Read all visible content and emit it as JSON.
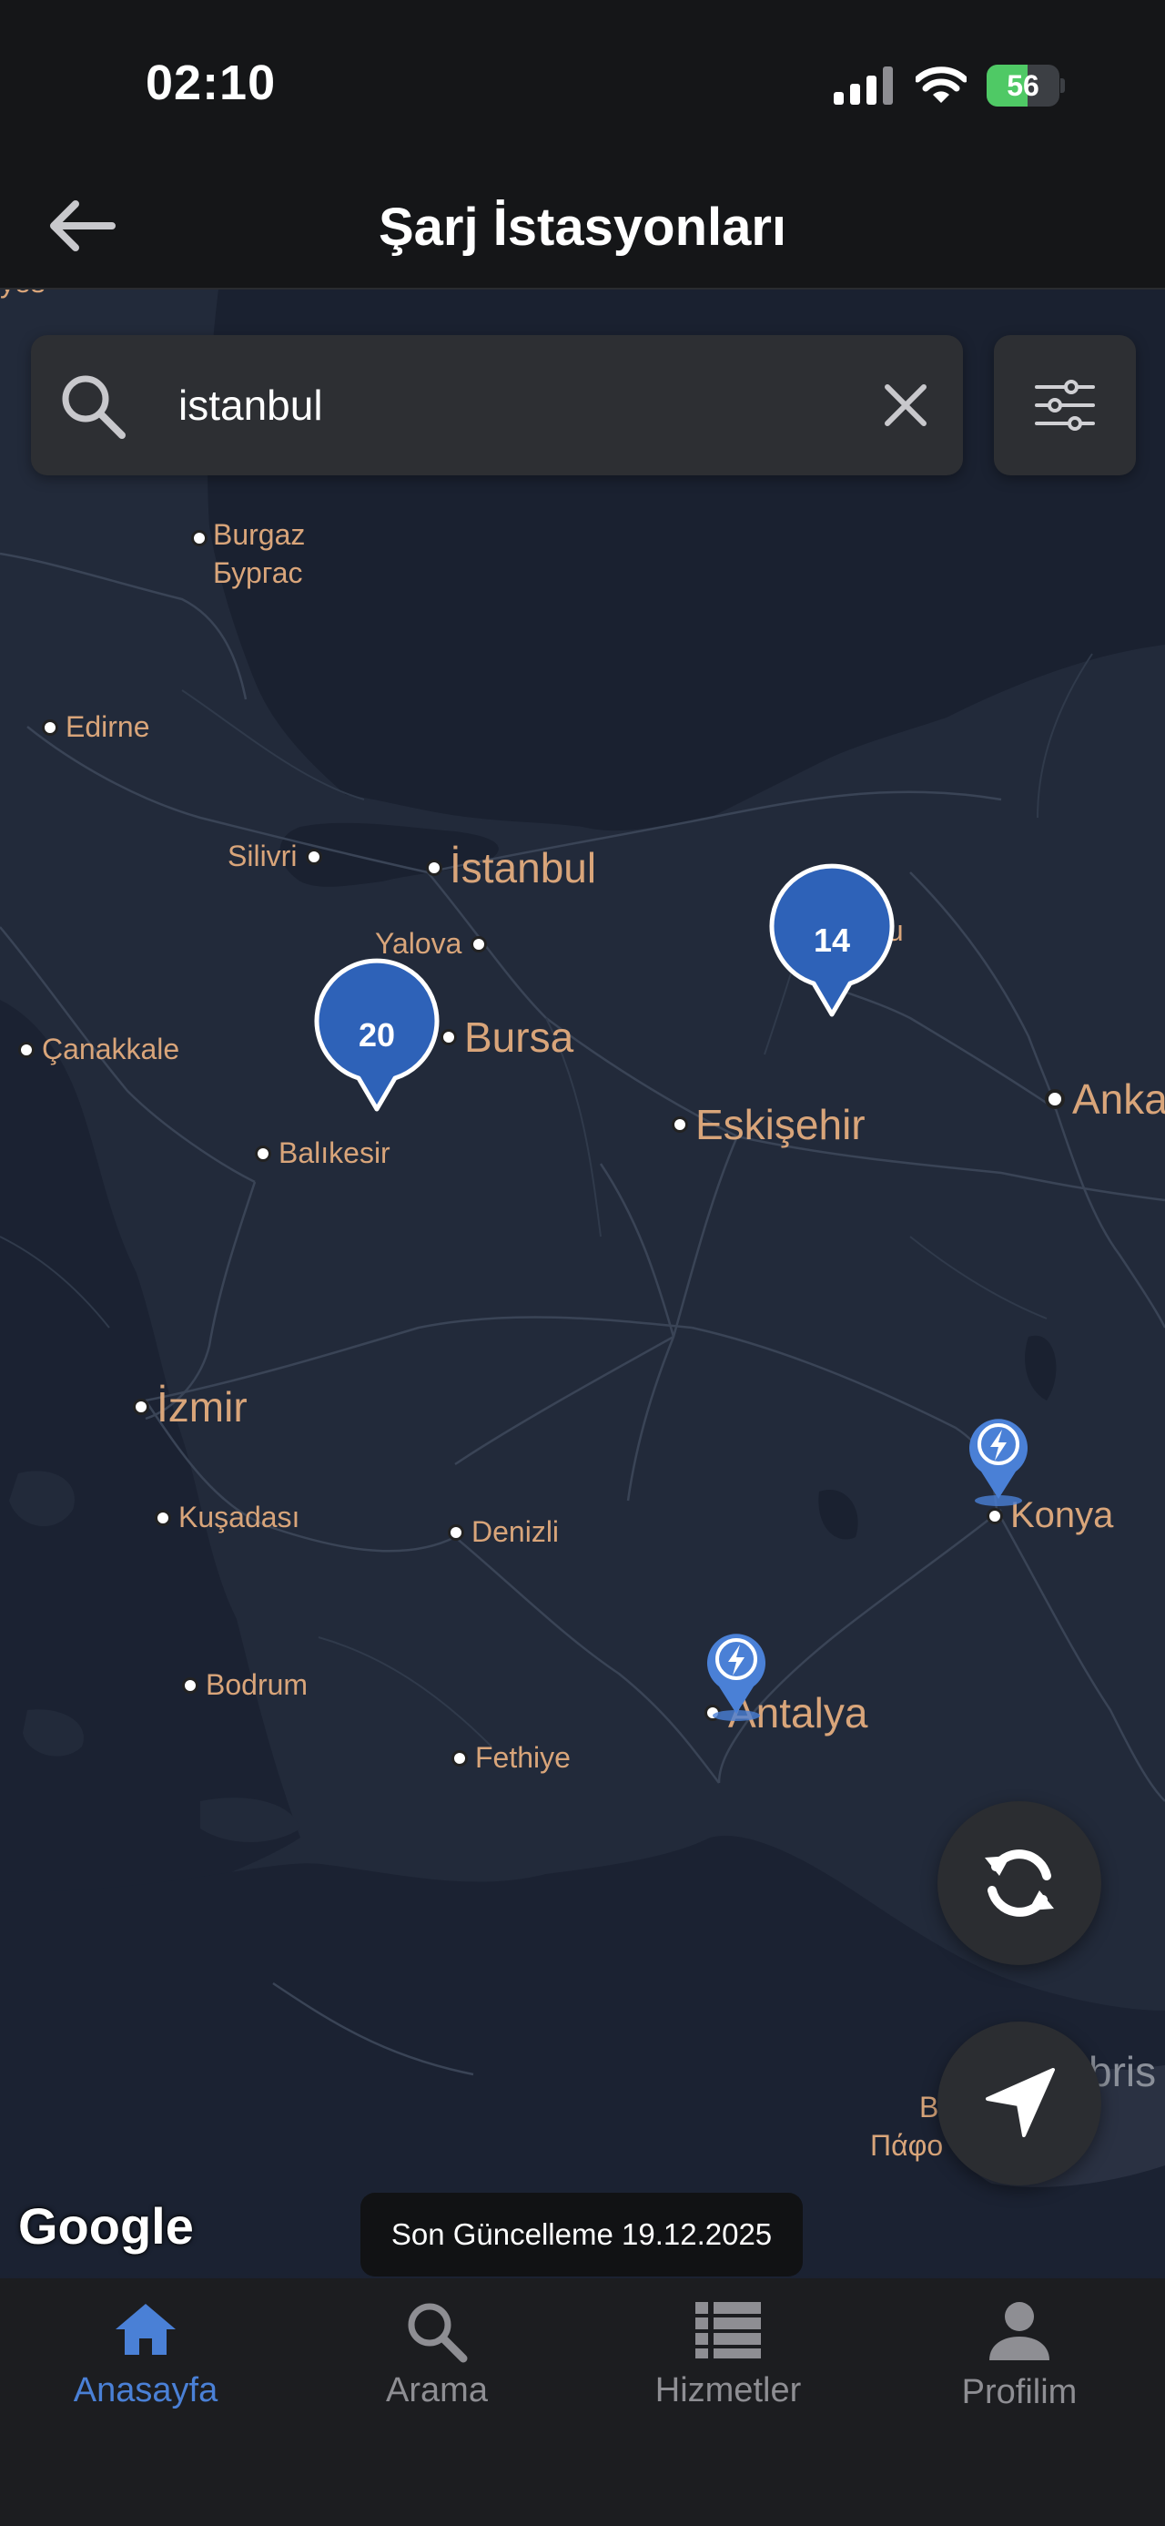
{
  "status_bar": {
    "time": "02:10",
    "battery_level": "56",
    "battery_fraction": 0.56,
    "icons": [
      "cellular-signal-icon",
      "wifi-icon",
      "battery-charging-icon"
    ]
  },
  "header": {
    "title": "Şarj İstasyonları",
    "back_icon": "arrow-left-icon"
  },
  "search": {
    "value": "istanbul",
    "placeholder": "",
    "search_icon": "search-icon",
    "clear_icon": "close-icon",
    "filter_icon": "sliders-icon"
  },
  "map": {
    "attribution": "Google",
    "cities": {
      "burgaz_latin": "Burgaz",
      "burgaz_cyrillic": "Бургас",
      "edirne": "Edirne",
      "silivri": "Silivri",
      "istanbul": "İstanbul",
      "yalova": "Yalova",
      "bursa": "Bursa",
      "canakkale": "Çanakkale",
      "balikesir": "Balıkesir",
      "eskisehir": "Eskişehir",
      "bolu_partial": "olu",
      "ankara_partial": "Anka",
      "izmir": "İzmir",
      "kusadasi": "Kuşadası",
      "denizli": "Denizli",
      "konya": "Konya",
      "bodrum": "Bodrum",
      "fethiye": "Fethiye",
      "antalya": "Antalya",
      "paphos_partial": "Πάφο",
      "paphos_partial_b": "B",
      "kibris_partial": "bris",
      "top_left_partial": "yes"
    },
    "clusters": [
      {
        "name": "bursa-cluster",
        "count": "20"
      },
      {
        "name": "bolu-cluster",
        "count": "14"
      }
    ],
    "stations": [
      {
        "name": "konya-station",
        "icon": "lightning-icon"
      },
      {
        "name": "antalya-station",
        "icon": "lightning-icon"
      }
    ],
    "last_update": "Son Güncelleme 19.12.2025",
    "refresh_icon": "refresh-icon",
    "locate_icon": "navigation-arrow-icon"
  },
  "tabs": [
    {
      "label": "Anasayfa",
      "icon": "home-icon",
      "active": true
    },
    {
      "label": "Arama",
      "icon": "search-icon",
      "active": false
    },
    {
      "label": "Hizmetler",
      "icon": "list-icon",
      "active": false
    },
    {
      "label": "Profilim",
      "icon": "person-icon",
      "active": false
    }
  ],
  "colors": {
    "accent": "#4a80d6",
    "cluster_blue": "#2e62b8",
    "map_background": "#212838",
    "sea": "#1b2231",
    "city_label": "#d9a57a",
    "inactive_tab": "#8e8e93"
  }
}
